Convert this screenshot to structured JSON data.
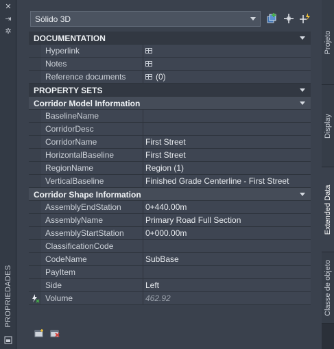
{
  "palette_title": "PROPRIEDADES",
  "object_type": "Sólido 3D",
  "sections": {
    "documentation": {
      "title": "DOCUMENTATION",
      "rows": [
        {
          "name": "Hyperlink",
          "value": ""
        },
        {
          "name": "Notes",
          "value": ""
        },
        {
          "name": "Reference documents",
          "value": "(0)"
        }
      ]
    },
    "property_sets": {
      "title": "PROPERTY SETS"
    },
    "corridor_model": {
      "title": "Corridor Model Information",
      "rows": [
        {
          "name": "BaselineName",
          "value": ""
        },
        {
          "name": "CorridorDesc",
          "value": ""
        },
        {
          "name": "CorridorName",
          "value": "First Street"
        },
        {
          "name": "HorizontalBaseline",
          "value": "First Street"
        },
        {
          "name": "RegionName",
          "value": "Region (1)"
        },
        {
          "name": "VerticalBaseline",
          "value": "Finished Grade Centerline - First Street"
        }
      ]
    },
    "corridor_shape": {
      "title": "Corridor Shape Information",
      "rows": [
        {
          "name": "AssemblyEndStation",
          "value": "0+440.00m"
        },
        {
          "name": "AssemblyName",
          "value": "Primary Road Full Section"
        },
        {
          "name": "AssemblyStartStation",
          "value": "0+000.00m"
        },
        {
          "name": "ClassificationCode",
          "value": ""
        },
        {
          "name": "CodeName",
          "value": "SubBase"
        },
        {
          "name": "PayItem",
          "value": ""
        },
        {
          "name": "Side",
          "value": "Left"
        },
        {
          "name": "Volume",
          "value": "462.92"
        }
      ]
    }
  },
  "tabs": [
    {
      "label": "Projeto",
      "active": false
    },
    {
      "label": "Display",
      "active": false
    },
    {
      "label": "Extended Data",
      "active": true
    },
    {
      "label": "Classe de objeto",
      "active": false
    }
  ],
  "icons": {
    "toolbar": [
      "add-selection-icon",
      "select-objects-icon",
      "quick-select-icon"
    ],
    "left_strip": [
      "close-icon",
      "auto-hide-icon",
      "settings-icon",
      "palette-menu-icon"
    ],
    "bottom": [
      "add-property-set-icon",
      "remove-property-set-icon"
    ],
    "formula": "formula-lightning-icon",
    "table": "table-icon"
  },
  "colors": {
    "panel_bg": "#3a414d",
    "section_bg": "#454c58",
    "major_section_bg": "#323842",
    "text": "#d6dbe2",
    "accent_green": "#46b04a"
  }
}
